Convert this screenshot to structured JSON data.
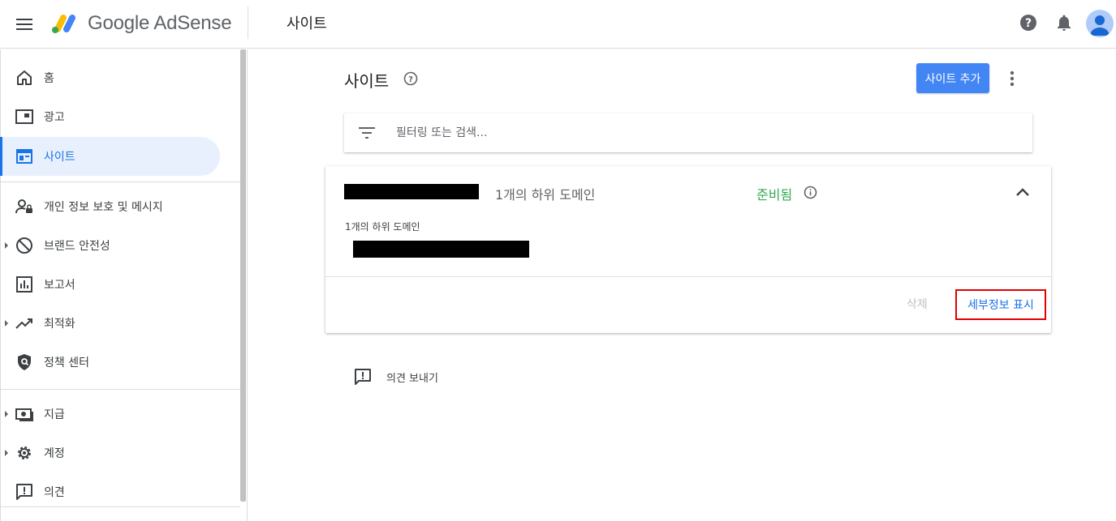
{
  "header": {
    "logo_text": "Google AdSense",
    "page_title": "사이트",
    "icons": [
      "menu-icon",
      "help-icon",
      "notifications-icon",
      "account-avatar"
    ]
  },
  "sidebar": {
    "items": [
      {
        "label": "홈",
        "icon": "home-icon"
      },
      {
        "label": "광고",
        "icon": "ads-icon"
      },
      {
        "label": "사이트",
        "icon": "sites-icon",
        "active": true
      },
      {
        "label": "개인 정보 보호 및 메시지",
        "icon": "privacy-icon"
      },
      {
        "label": "브랜드 안전성",
        "icon": "block-icon",
        "expandable": true
      },
      {
        "label": "보고서",
        "icon": "reports-icon"
      },
      {
        "label": "최적화",
        "icon": "trending-icon",
        "expandable": true
      },
      {
        "label": "정책 센터",
        "icon": "policy-shield-icon"
      },
      {
        "label": "지급",
        "icon": "payments-icon",
        "expandable": true
      },
      {
        "label": "계정",
        "icon": "gear-icon",
        "expandable": true
      },
      {
        "label": "의견",
        "icon": "feedback-icon"
      }
    ]
  },
  "main": {
    "title": "사이트",
    "add_button": "사이트 추가",
    "filter_placeholder": "필터링 또는 검색...",
    "card": {
      "subdomain_count": "1개의 하위 도메인",
      "status": "준비됨",
      "sub_label": "1개의 하위 도메인",
      "delete_button": "삭제",
      "details_button": "세부정보 표시"
    },
    "feedback": "의견 보내기"
  },
  "colors": {
    "accent": "#1a73e8",
    "button": "#4285f4",
    "status_ready": "#34a853",
    "highlight_box": "#e00000"
  }
}
